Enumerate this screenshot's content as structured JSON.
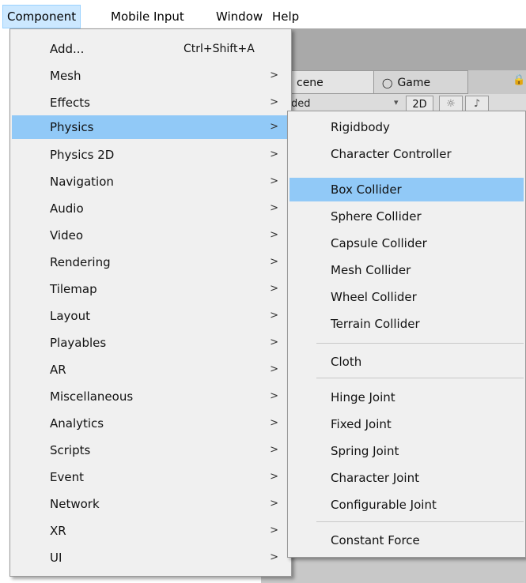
{
  "menubar": {
    "items": [
      "Component",
      "Mobile Input",
      "Window",
      "Help"
    ]
  },
  "editor": {
    "tab_scene": "cene",
    "tab_game": "Game",
    "shading_mode": "ded",
    "btn_2d": "2D"
  },
  "component_menu": {
    "items": [
      {
        "label": "Add...",
        "shortcut": "Ctrl+Shift+A"
      },
      {
        "label": "Mesh"
      },
      {
        "label": "Effects"
      },
      {
        "label": "Physics"
      },
      {
        "label": "Physics 2D"
      },
      {
        "label": "Navigation"
      },
      {
        "label": "Audio"
      },
      {
        "label": "Video"
      },
      {
        "label": "Rendering"
      },
      {
        "label": "Tilemap"
      },
      {
        "label": "Layout"
      },
      {
        "label": "Playables"
      },
      {
        "label": "AR"
      },
      {
        "label": "Miscellaneous"
      },
      {
        "label": "Analytics"
      },
      {
        "label": "Scripts"
      },
      {
        "label": "Event"
      },
      {
        "label": "Network"
      },
      {
        "label": "XR"
      },
      {
        "label": "UI"
      }
    ]
  },
  "physics_submenu": {
    "items": [
      {
        "label": "Rigidbody"
      },
      {
        "label": "Character Controller"
      },
      {
        "label": "Box Collider"
      },
      {
        "label": "Sphere Collider"
      },
      {
        "label": "Capsule Collider"
      },
      {
        "label": "Mesh Collider"
      },
      {
        "label": "Wheel Collider"
      },
      {
        "label": "Terrain Collider"
      },
      {
        "label": "Cloth"
      },
      {
        "label": "Hinge Joint"
      },
      {
        "label": "Fixed Joint"
      },
      {
        "label": "Spring Joint"
      },
      {
        "label": "Character Joint"
      },
      {
        "label": "Configurable Joint"
      },
      {
        "label": "Constant Force"
      }
    ]
  },
  "colors": {
    "highlight": "#91c9f7",
    "active_menu": "#cce8ff",
    "menu_bg": "#f0f0f0"
  }
}
